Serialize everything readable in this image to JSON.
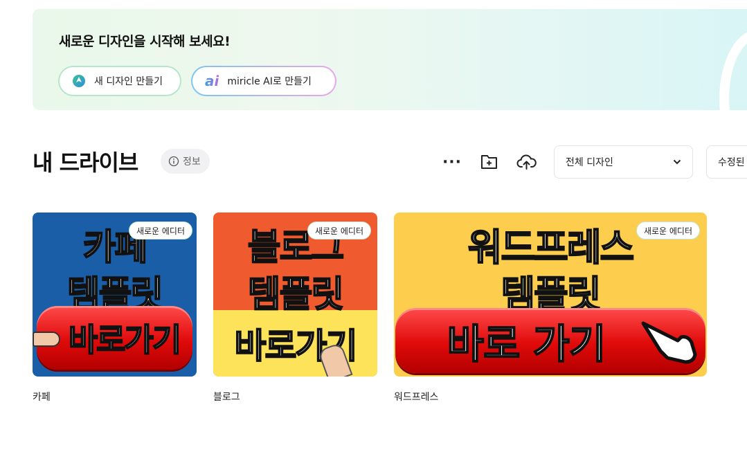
{
  "hero": {
    "title": "새로운 디자인을 시작해 보세요!",
    "new_design_label": "새 디자인 만들기",
    "ai_label": "miricle AI로 만들기",
    "ai_icon_text": "ai"
  },
  "drive": {
    "title": "내 드라이브",
    "info_label": "정보"
  },
  "toolbar": {
    "more_label": "···",
    "filter_value": "전체 디자인",
    "sort_value": "수정된"
  },
  "cards": [
    {
      "badge": "새로운 에디터",
      "thumb_line1": "카페",
      "thumb_line2": "템플릿",
      "thumb_button": "바로가기",
      "caption": "카페"
    },
    {
      "badge": "새로운 에디터",
      "thumb_line1": "블로그",
      "thumb_line2": "템플릿",
      "thumb_button": "바로가기",
      "caption": "블로그"
    },
    {
      "badge": "새로운 에디터",
      "thumb_line1": "워드프레스",
      "thumb_line2": "템플릿",
      "thumb_button": "바로 가기",
      "caption": "워드프레스"
    }
  ],
  "colors": {
    "accent_green": "#b6e6c9",
    "card1_bg": "#1b5ea8",
    "card2_bg": "#ef5a2f",
    "card3_bg": "#fdcd4d"
  }
}
